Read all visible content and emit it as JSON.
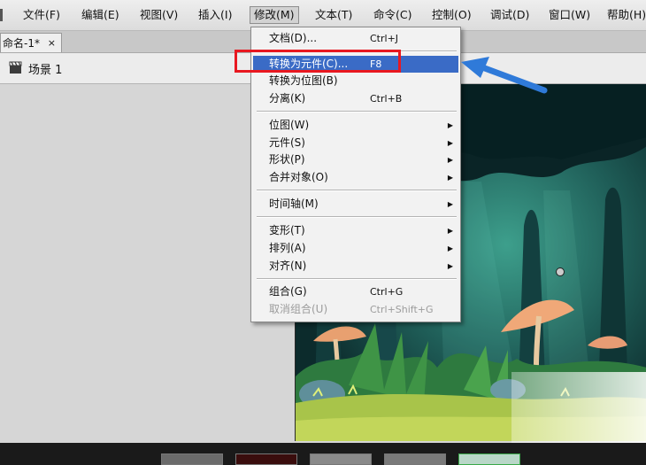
{
  "menubar": {
    "items": [
      {
        "label": "文件(F)"
      },
      {
        "label": "编辑(E)"
      },
      {
        "label": "视图(V)"
      },
      {
        "label": "插入(I)"
      },
      {
        "label": "修改(M)"
      },
      {
        "label": "文本(T)"
      },
      {
        "label": "命令(C)"
      },
      {
        "label": "控制(O)"
      },
      {
        "label": "调试(D)"
      },
      {
        "label": "窗口(W)"
      },
      {
        "label": "帮助(H)"
      }
    ]
  },
  "document_tab": {
    "label": "命名-1*",
    "close": "×"
  },
  "scene": {
    "label": "场景 1"
  },
  "modify_menu": {
    "items": [
      {
        "label": "文档(D)...",
        "shortcut": "Ctrl+J"
      },
      {
        "label": "转换为元件(C)...",
        "shortcut": "F8"
      },
      {
        "label": "转换为位图(B)",
        "shortcut": ""
      },
      {
        "label": "分离(K)",
        "shortcut": "Ctrl+B"
      },
      {
        "label": "位图(W)",
        "shortcut": ""
      },
      {
        "label": "元件(S)",
        "shortcut": ""
      },
      {
        "label": "形状(P)",
        "shortcut": ""
      },
      {
        "label": "合并对象(O)",
        "shortcut": ""
      },
      {
        "label": "时间轴(M)",
        "shortcut": ""
      },
      {
        "label": "变形(T)",
        "shortcut": ""
      },
      {
        "label": "排列(A)",
        "shortcut": ""
      },
      {
        "label": "对齐(N)",
        "shortcut": ""
      },
      {
        "label": "组合(G)",
        "shortcut": "Ctrl+G"
      },
      {
        "label": "取消组合(U)",
        "shortcut": "Ctrl+Shift+G"
      }
    ],
    "highlighted_index": 1,
    "disabled_indices": [
      13
    ]
  },
  "icons": {
    "scene": "clapperboard-icon",
    "submenu": "triangle-right-icon",
    "annotation": "blue-arrow-icon"
  },
  "colors": {
    "highlight": "#3a6bc6",
    "annotation_box": "#e81820",
    "annotation_arrow": "#2f7ad9"
  }
}
